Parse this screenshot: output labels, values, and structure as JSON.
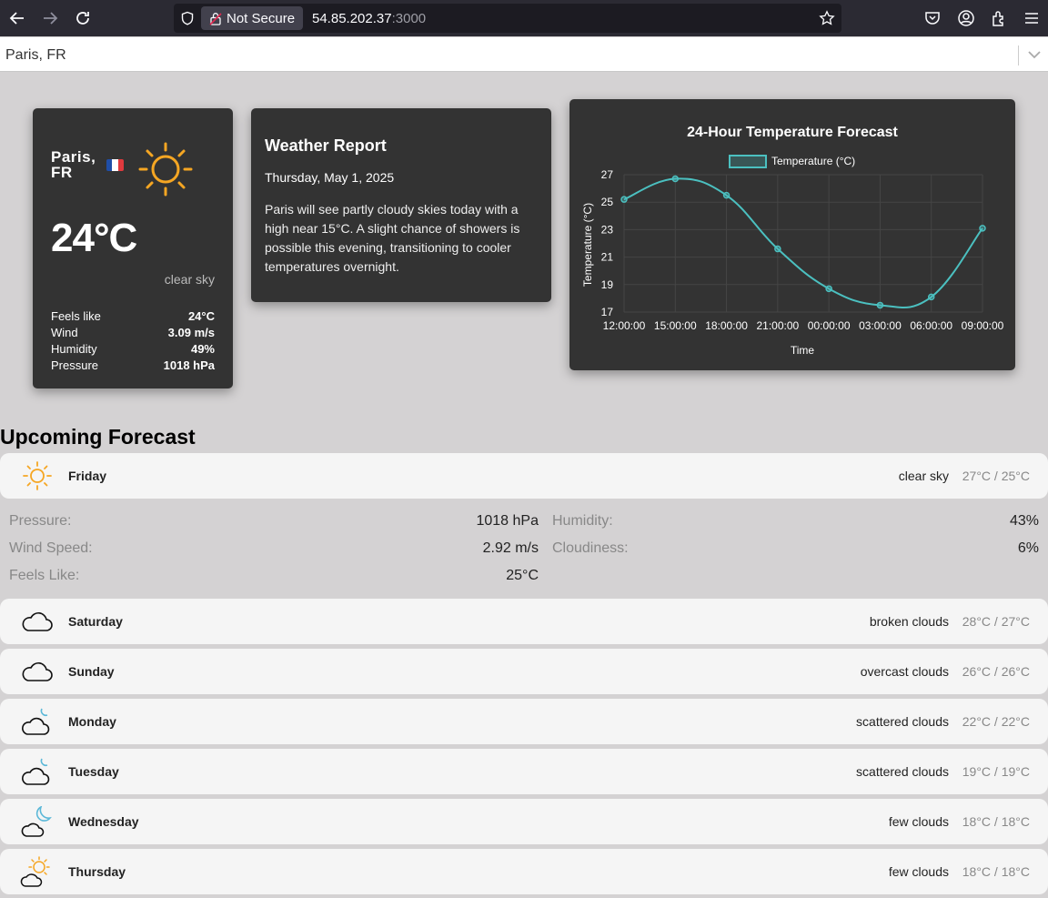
{
  "browser": {
    "security_label": "Not Secure",
    "url_host": "54.85.202.37",
    "url_port": ":3000"
  },
  "location_select": {
    "value": "Paris, FR"
  },
  "current": {
    "city": "Paris,",
    "country": "FR",
    "temperature": "24°C",
    "description": "clear sky",
    "stats": [
      {
        "label": "Feels like",
        "value": "24°C"
      },
      {
        "label": "Wind",
        "value": "3.09 m/s"
      },
      {
        "label": "Humidity",
        "value": "49%"
      },
      {
        "label": "Pressure",
        "value": "1018 hPa"
      }
    ]
  },
  "report": {
    "title": "Weather Report",
    "date": "Thursday, May 1, 2025",
    "text": "Paris will see partly cloudy skies today with a high near 15°C. A slight chance of showers is possible this evening, transitioning to cooler temperatures overnight."
  },
  "chart_data": {
    "type": "line",
    "title": "24-Hour Temperature Forecast",
    "xlabel": "Time",
    "ylabel": "Temperature (°C)",
    "x": [
      "12:00:00",
      "15:00:00",
      "18:00:00",
      "21:00:00",
      "00:00:00",
      "03:00:00",
      "06:00:00",
      "09:00:00"
    ],
    "series": [
      {
        "name": "Temperature (°C)",
        "values": [
          25.2,
          26.7,
          25.5,
          21.6,
          18.7,
          17.5,
          18.1,
          23.1
        ]
      }
    ],
    "ylim": [
      17,
      27
    ],
    "yticks": [
      "27",
      "25",
      "23",
      "21",
      "19",
      "17"
    ],
    "color": "#4bc0c0",
    "grid": true,
    "legend": "top"
  },
  "upcoming": {
    "title": "Upcoming Forecast",
    "days": [
      {
        "day": "Friday",
        "condition": "clear sky",
        "range": "27°C / 25°C",
        "icon": "sun-icon"
      },
      {
        "day": "Saturday",
        "condition": "broken clouds",
        "range": "28°C / 27°C",
        "icon": "cloud-icon"
      },
      {
        "day": "Sunday",
        "condition": "overcast clouds",
        "range": "26°C / 26°C",
        "icon": "cloud-icon"
      },
      {
        "day": "Monday",
        "condition": "scattered clouds",
        "range": "22°C / 22°C",
        "icon": "cloud-moon-icon"
      },
      {
        "day": "Tuesday",
        "condition": "scattered clouds",
        "range": "19°C / 19°C",
        "icon": "cloud-moon-icon"
      },
      {
        "day": "Wednesday",
        "condition": "few clouds",
        "range": "18°C / 18°C",
        "icon": "cloud-moon-icon"
      },
      {
        "day": "Thursday",
        "condition": "few clouds",
        "range": "18°C / 18°C",
        "icon": "sun-cloud-icon"
      }
    ],
    "details": {
      "pressure_label": "Pressure:",
      "pressure": "1018 hPa",
      "wind_label": "Wind Speed:",
      "wind": "2.92 m/s",
      "feels_label": "Feels Like:",
      "feels": "25°C",
      "humidity_label": "Humidity:",
      "humidity": "43%",
      "cloud_label": "Cloudiness:",
      "cloud": "6%"
    }
  }
}
